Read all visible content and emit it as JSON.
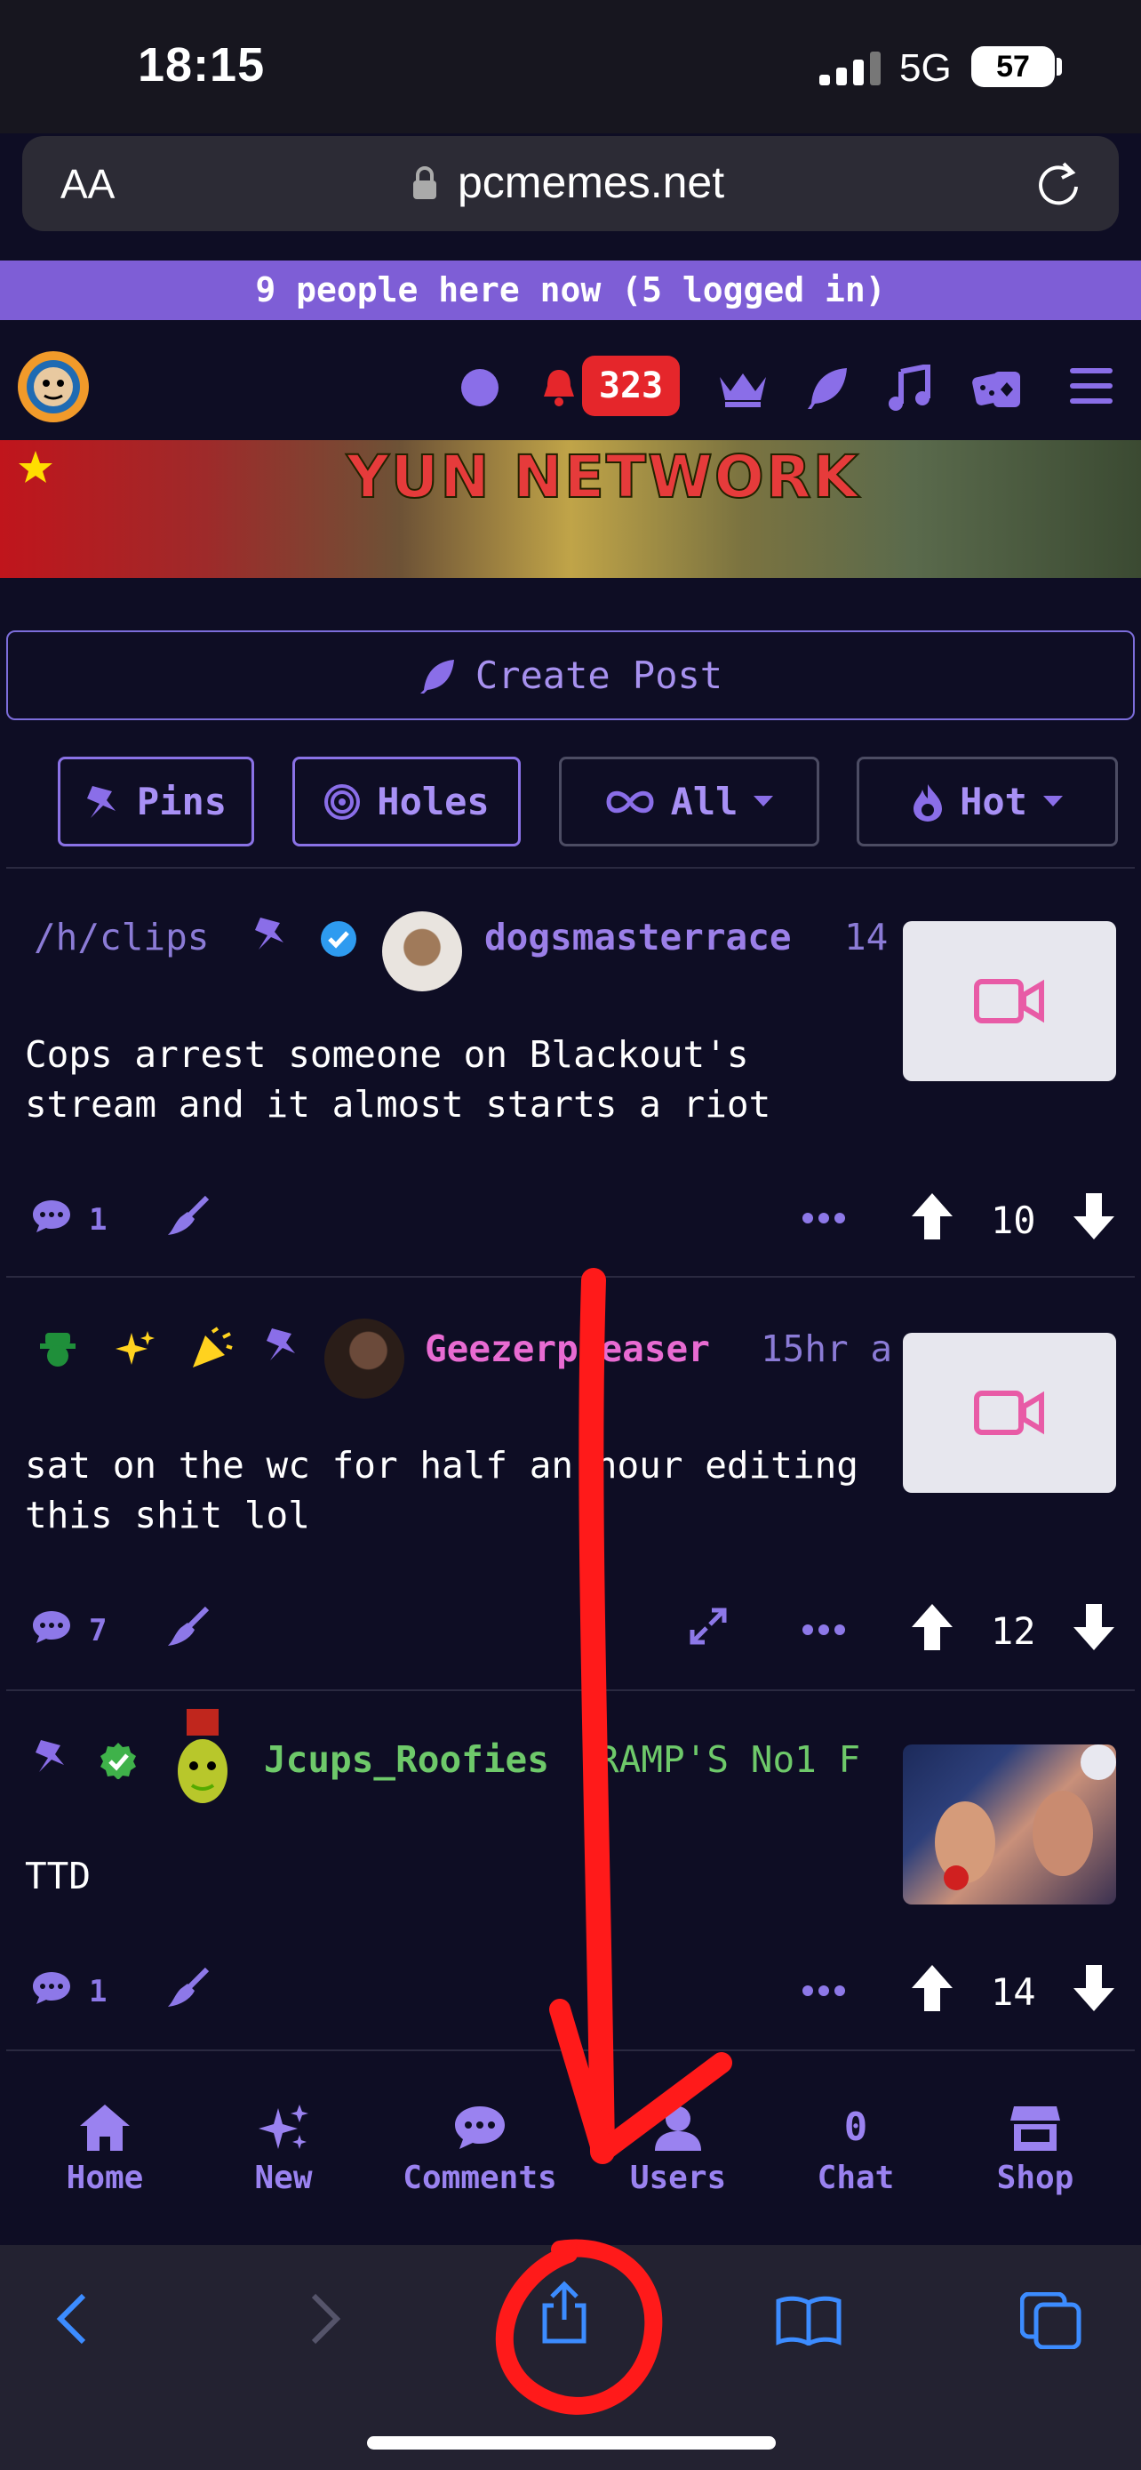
{
  "status_bar": {
    "time": "18:15",
    "network": "5G",
    "battery": "57"
  },
  "browser": {
    "aa_label": "AA",
    "url": "pcmemes.net"
  },
  "presence": {
    "text": "9 people here now (5 logged in)"
  },
  "header": {
    "notification_count": "323"
  },
  "banner": {
    "title": "YUN NETWORK"
  },
  "create_post": {
    "label": "Create Post"
  },
  "filters": {
    "pins": "Pins",
    "holes": "Holes",
    "all": "All",
    "hot": "Hot"
  },
  "posts": [
    {
      "hole": "/h/clips",
      "username": "dogsmasterrace",
      "username_color": "#9b7fe8",
      "time": "14",
      "title_line1": "Cops arrest someone on Blackout's",
      "title_line2": "stream and it almost starts a riot",
      "comments": "1",
      "score": "10"
    },
    {
      "username": "Geezerpleaser",
      "username_color": "#e86bd2",
      "time": "15hr a",
      "title_line1": "sat on the wc for half an hour editing",
      "title_line2": "this shit lol",
      "comments": "7",
      "score": "12"
    },
    {
      "username": "Jcups_Roofies",
      "username_color": "#6ec96a",
      "flair": "RAMP'S No1 F",
      "title_line1": "TTD",
      "comments": "1",
      "score": "14"
    }
  ],
  "bottom_nav": {
    "home": "Home",
    "new": "New",
    "comments": "Comments",
    "users": "Users",
    "chat_count": "0",
    "chat": "Chat",
    "shop": "Shop"
  },
  "colors": {
    "accent": "#7e5ed6",
    "background": "#0e0d24",
    "annotation_red": "#ff1a1a"
  }
}
